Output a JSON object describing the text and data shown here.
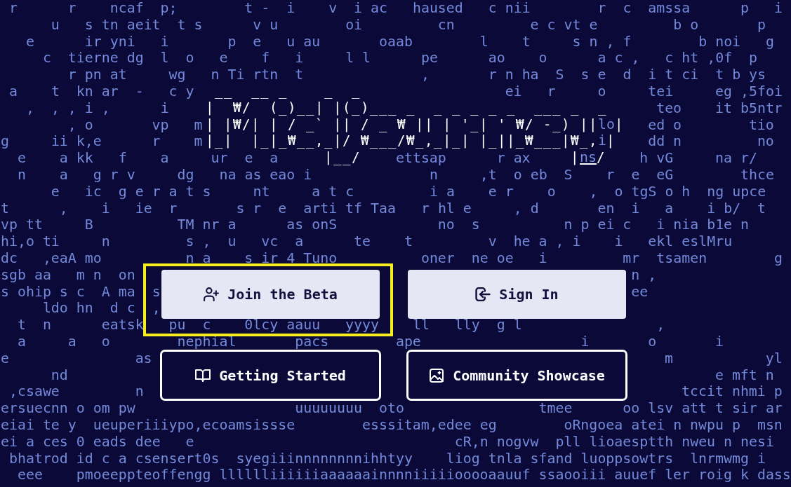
{
  "background_rain": {
    "rows": [
      " r      r    ncaf  p;        t -  i    v  i ac   haused   c nii        r  c  amssa      p   i",
      "      u   s tn aeit  t s      v u        oi         cn         e c vt e         b o       p",
      "   e      ir yni   i       p  e   u au       oaab        l    t     s n , f        b noi   g",
      "     c  tierne dg  l  o   e    f   i     l l      pe      ao    o      a c ,   c ht ,0f  p",
      "        r pn at     wg   n Ti rtn  t              ,       r n ha  S  s e  d  i t ci  t b ys",
      " a    t  kn ar  -   c y                                     ei   r     o     tei     eg ,5foi",
      "   ,  , , i ,      i                                                          teo    it b5ntr",
      "        , o       vp   m                                                     ed o        tio",
      "g     ii k,e      r    m                                                     dd n         no",
      "  e    a kk   f    a     ur  e  a              ettsap      r ax             h vG     na r/",
      "  n    a   g r v     dg   na as eao i              n     ,t  o eb  S    r  e  eG        thce",
      "      e   ic  g e r a t s     nt     a t c         i a    e r    o    ,  o tgS o h  ng upce",
      "t      ,    i   ie  r       s r  e  arti tf Taa   r hl e     , d       en  i   a    i b/  t",
      "vp tt     B          TM nr a      as onS            no  s          n p ei c   i nia b1e n",
      "hi,o ti     n         s ,  u   vc  a      te    t         v  he a , i    i   ekl eslMru",
      "dc   ,eaA mo          n a    s ir 4 Tuno          oner  ne oe   i         mr  tsamen        g",
      "sgb aa   m n  on                                                           n ,",
      "s ohip s c  A ma  s                                                        ee",
      "     ldo hn  d c  ,",
      "  t  n      eatsk   pu  c    0lcy aauu   yyyy    ll   lly  g l                ,",
      "  a     a   o        nephial       pacs        ape                   i       o       i",
      "e               as                                                             m           yl",
      "      nd                                                                             e mft n",
      " ,csawe         n                                                                tccit nhmi p",
      "ersuecnn o om pw                   uuuuuuuu  oto                tmee      oo lsv att t sir ar",
      "eiai te y  ueuperiiiypo,ecoamsissse        esssitam,edee eg        oRngoea atei n nwpu p  msn",
      "ei a ces 0 eads dee   e                               cR,n nogvw  pll lioaesptth nweu n nesi",
      " bhatrod id c a csensert0s  syegiiinnnnnnnnihhtyy    liog tnla sfand luoppsowtrs  lnrmwmg i",
      "  eee    pmoeeppteoffengg lllllliiiiiiaaaaaainnnniiiiiooooaauuf ssaooiii auuef ler roig k dass"
    ]
  },
  "logo": {
    "lines": [
      {
        "segments": [
          {
            "kind": "logo",
            "text": " __  __ _    _  _"
          }
        ]
      },
      {
        "segments": [
          {
            "kind": "logo",
            "text": "|  ₩/  (_)__| |(_)___ _  _ _ _ _ _  ___ _  _"
          }
        ]
      },
      {
        "segments": [
          {
            "kind": "logo",
            "text": "| |₩/| | / _` || / _ ₩ || | '_| ' ₩/ -_) ||"
          },
          {
            "kind": "rain",
            "text": "lo",
            "underlined": false
          },
          {
            "kind": "logo",
            "text": "|"
          }
        ]
      },
      {
        "segments": [
          {
            "kind": "logo",
            "text": "|_|  |_|_₩__,_|/ ₩___/₩_,_|_| |_||_₩___|₩_,"
          },
          {
            "kind": "rain",
            "text": "i",
            "underlined": false
          },
          {
            "kind": "logo",
            "text": "|"
          }
        ]
      },
      {
        "segments": [
          {
            "kind": "logo",
            "text": "             |__/                       |"
          },
          {
            "kind": "rain",
            "text": "ns",
            "underlined": true
          },
          {
            "kind": "logo",
            "text": "/"
          }
        ]
      }
    ]
  },
  "actions": [
    {
      "label": "Join the Beta",
      "kind": "filled",
      "highlighted": true
    },
    {
      "label": "Sign In",
      "kind": "filled",
      "highlighted": false
    },
    {
      "label": "Getting Started",
      "kind": "outlined",
      "highlighted": false
    },
    {
      "label": "Community Showcase",
      "kind": "outlined",
      "highlighted": false
    }
  ]
}
